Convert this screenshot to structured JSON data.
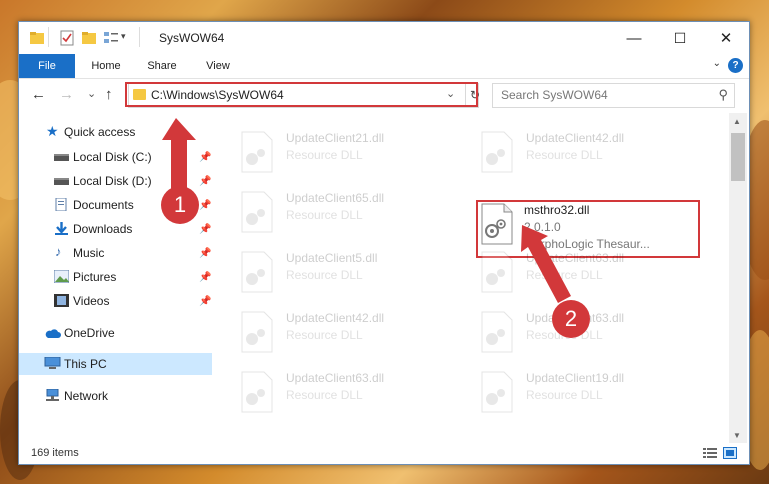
{
  "window": {
    "title": "SysWOW64",
    "minimize_glyph": "—",
    "maximize_glyph": "☐",
    "close_glyph": "✕"
  },
  "ribbon": {
    "tabs": [
      "File",
      "Home",
      "Share",
      "View"
    ],
    "help": "?"
  },
  "navigation": {
    "back": "←",
    "forward": "→",
    "recent": "⌄",
    "up": "↑",
    "address": "C:\\Windows\\SysWOW64",
    "refresh": "↻",
    "search_placeholder": "Search SysWOW64"
  },
  "sidebar": {
    "items": [
      {
        "label": "Quick access",
        "icon": "star-icon",
        "pinned": false
      },
      {
        "label": "Local Disk (C:)",
        "icon": "drive-icon",
        "pinned": true
      },
      {
        "label": "Local Disk (D:)",
        "icon": "drive-icon",
        "pinned": true
      },
      {
        "label": "Documents",
        "icon": "documents-icon",
        "pinned": true
      },
      {
        "label": "Downloads",
        "icon": "download-icon",
        "pinned": true
      },
      {
        "label": "Music",
        "icon": "music-icon",
        "pinned": true
      },
      {
        "label": "Pictures",
        "icon": "pictures-icon",
        "pinned": true
      },
      {
        "label": "Videos",
        "icon": "videos-icon",
        "pinned": true
      },
      {
        "label": "OneDrive",
        "icon": "cloud-icon",
        "pinned": false
      },
      {
        "label": "This PC",
        "icon": "pc-icon",
        "pinned": false,
        "selected": true
      },
      {
        "label": "Network",
        "icon": "network-icon",
        "pinned": false
      }
    ]
  },
  "files": [
    {
      "name": "UpdateClient21.dll",
      "desc": "Resource DLL",
      "faded": true
    },
    {
      "name": "UpdateClient42.dll",
      "desc": "Resource DLL",
      "faded": true
    },
    {
      "name": "UpdateClient65.dll",
      "desc": "Resource DLL",
      "faded": true
    },
    {
      "name": "msthro32.dll",
      "desc": "2.0.1.0",
      "desc2": "MorphoLogic Thesaur...",
      "faded": false
    },
    {
      "name": "UpdateClient5.dll",
      "desc": "Resource DLL",
      "faded": true
    },
    {
      "name": "UpdateClient63.dll",
      "desc": "Resource DLL",
      "faded": true
    },
    {
      "name": "UpdateClient42.dll",
      "desc": "Resource DLL",
      "faded": true
    },
    {
      "name": "UpdateClient63.dll",
      "desc": "Resource DLL",
      "faded": true
    },
    {
      "name": "UpdateClient63.dll",
      "desc": "Resource DLL",
      "faded": true
    },
    {
      "name": "UpdateClient19.dll",
      "desc": "Resource DLL",
      "faded": true
    }
  ],
  "status": {
    "item_count": "169 items"
  },
  "annotations": {
    "step1": "1",
    "step2": "2",
    "color": "#d2383a"
  },
  "colors": {
    "accent": "#1a6fc7",
    "selection": "#cce8ff"
  }
}
